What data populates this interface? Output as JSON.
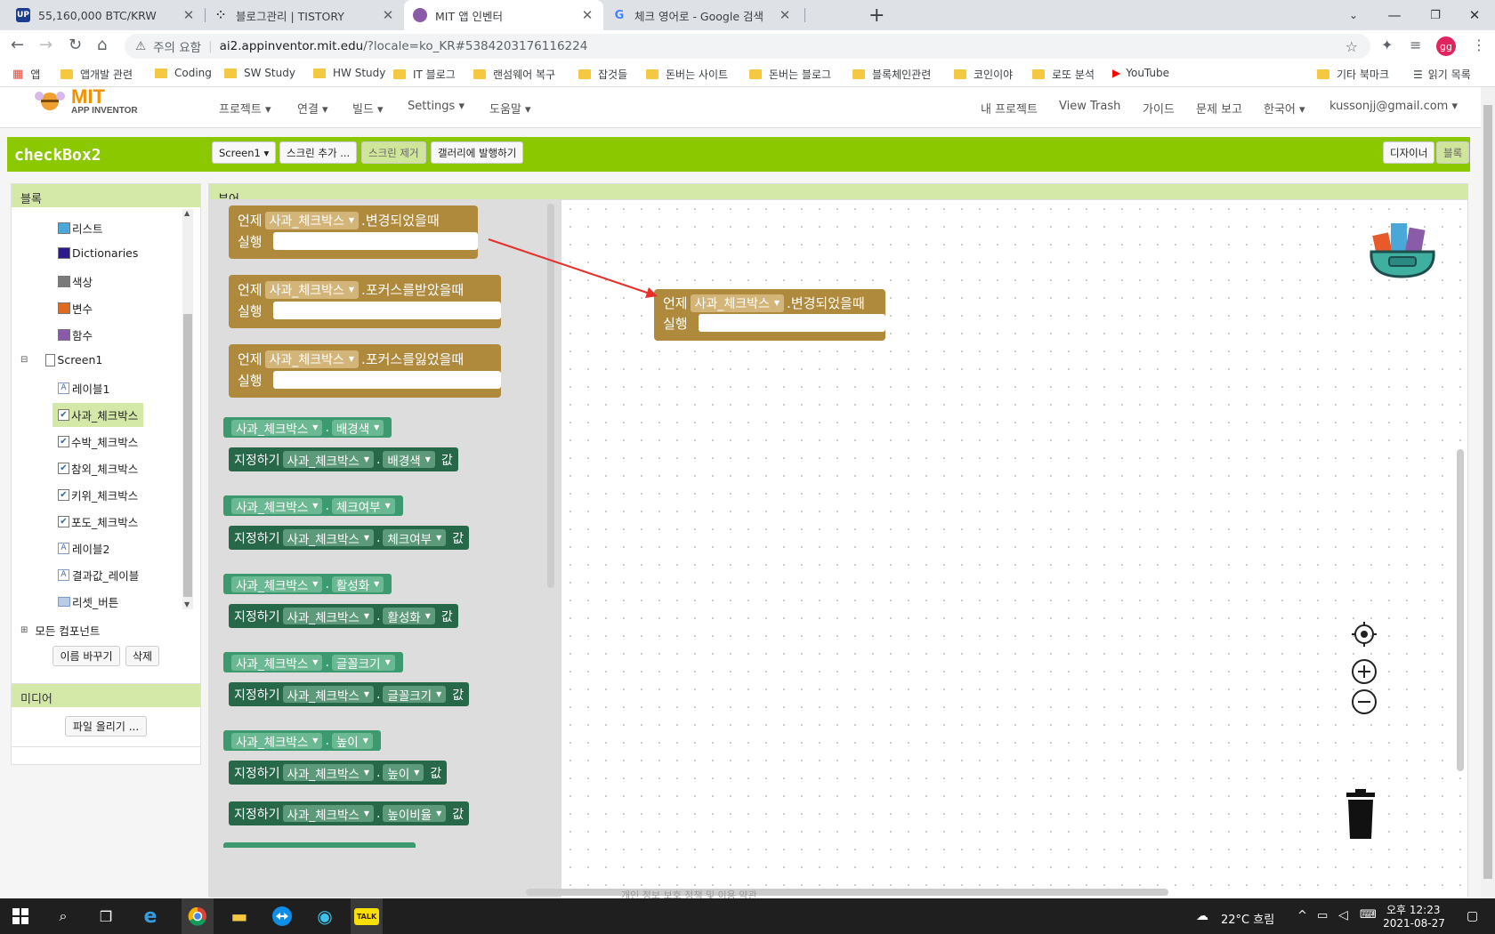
{
  "browser": {
    "tabs": [
      {
        "title": "55,160,000 BTC/KRW",
        "favicon": "upbit-icon",
        "color": "#1a3d8f"
      },
      {
        "title": "블로그관리 | TISTORY",
        "favicon": "tistory-icon",
        "color": "#333333"
      },
      {
        "title": "MIT 앱 인벤터",
        "favicon": "appinventor-icon",
        "color": "#8a5ba8"
      },
      {
        "title": "체크 영어로 - Google 검색",
        "favicon": "google-icon",
        "color": "#4285f4"
      }
    ],
    "url_warning": "주의 요함",
    "url_host": "ai2.appinventor.mit.edu",
    "url_path": "/?locale=ko_KR#5384203176116224",
    "avatar_text": "gg",
    "bookmarks": [
      "앱",
      "앱개발 관련",
      "Coding",
      "SW Study",
      "HW Study",
      "IT 블로그",
      "랜섬웨어 복구",
      "잡것들",
      "돈버는 사이트",
      "돈버는 블로그",
      "블록체인관련",
      "코인이야",
      "로또 분석",
      "YouTube"
    ],
    "bookmarks_right": [
      "기타 북마크",
      "읽기 목록"
    ]
  },
  "appinventor": {
    "logo_title": "MIT",
    "logo_subtitle": "APP INVENTOR",
    "menu_left": [
      "프로젝트 ▾",
      "연결 ▾",
      "빌드 ▾",
      "Settings ▾",
      "도움말 ▾"
    ],
    "menu_right": [
      "내 프로젝트",
      "View Trash",
      "가이드",
      "문제 보고",
      "한국어 ▾",
      "kussonjj@gmail.com ▾"
    ],
    "project_name": "checkBox2",
    "screen_select": "Screen1 ▾",
    "add_screen": "스크린 추가 ...",
    "remove_screen": "스크린 제거",
    "publish_gallery": "갤러리에 발행하기",
    "designer_btn": "디자이너",
    "blocks_btn": "블록",
    "blocks_panel_title": "블록",
    "viewer_title": "뷰어",
    "media_panel_title": "미디어",
    "upload_file": "파일 올리기 ...",
    "rename_btn": "이름 바꾸기",
    "delete_btn": "삭제",
    "tree": [
      {
        "label": "리스트",
        "color": "#4aa8d8",
        "kind": "builtin"
      },
      {
        "label": "Dictionaries",
        "color": "#2d1a8a",
        "kind": "builtin"
      },
      {
        "label": "색상",
        "color": "#7a7a7a",
        "kind": "builtin"
      },
      {
        "label": "변수",
        "color": "#e06a1e",
        "kind": "builtin"
      },
      {
        "label": "함수",
        "color": "#8a5ba8",
        "kind": "builtin"
      },
      {
        "label": "Screen1",
        "kind": "screen"
      },
      {
        "label": "레이블1",
        "kind": "label"
      },
      {
        "label": "사과_체크박스",
        "kind": "checkbox",
        "selected": true
      },
      {
        "label": "수박_체크박스",
        "kind": "checkbox"
      },
      {
        "label": "참외_체크박스",
        "kind": "checkbox"
      },
      {
        "label": "키위_체크박스",
        "kind": "checkbox"
      },
      {
        "label": "포도_체크박스",
        "kind": "checkbox"
      },
      {
        "label": "레이블2",
        "kind": "label"
      },
      {
        "label": "결과값_레이블",
        "kind": "label"
      },
      {
        "label": "리셋_버튼",
        "kind": "button"
      },
      {
        "label": "모든 컴포넌트",
        "kind": "all"
      }
    ],
    "flyout_events": [
      {
        "when": "언제",
        "component": "사과_체크박스",
        "event": ".변경되었을때",
        "do": "실행"
      },
      {
        "when": "언제",
        "component": "사과_체크박스",
        "event": ".포커스를받았을때",
        "do": "실행"
      },
      {
        "when": "언제",
        "component": "사과_체크박스",
        "event": ".포커스를잃었을때",
        "do": "실행"
      }
    ],
    "flyout_props": [
      {
        "get_component": "사과_체크박스",
        "property": "배경색",
        "set_label": "지정하기",
        "value_label": "값"
      },
      {
        "get_component": "사과_체크박스",
        "property": "체크여부",
        "set_label": "지정하기",
        "value_label": "값"
      },
      {
        "get_component": "사과_체크박스",
        "property": "활성화",
        "set_label": "지정하기",
        "value_label": "값"
      },
      {
        "get_component": "사과_체크박스",
        "property": "글꼴크기",
        "set_label": "지정하기",
        "value_label": "값"
      },
      {
        "get_component": "사과_체크박스",
        "property": "높이",
        "set_label": "지정하기",
        "value_label": "값"
      }
    ],
    "flyout_last_set": {
      "set_label": "지정하기",
      "component": "사과_체크박스",
      "property": "높이비율",
      "value_label": "값"
    },
    "canvas_block": {
      "when": "언제",
      "component": "사과_체크박스",
      "event": ".변경되었을때",
      "do": "실행"
    },
    "footer_text": "개인 정보 보호 정책 및 이용 약관"
  },
  "taskbar": {
    "weather": "22°C 흐림",
    "time": "오후 12:23",
    "date": "2021-08-27",
    "kakao": "TALK"
  },
  "colors": {
    "accent_green": "#8cc800",
    "event_block": "#b08a3c",
    "getter_block": "#3d9970",
    "setter_block": "#266847",
    "arrow": "#e8302a"
  }
}
